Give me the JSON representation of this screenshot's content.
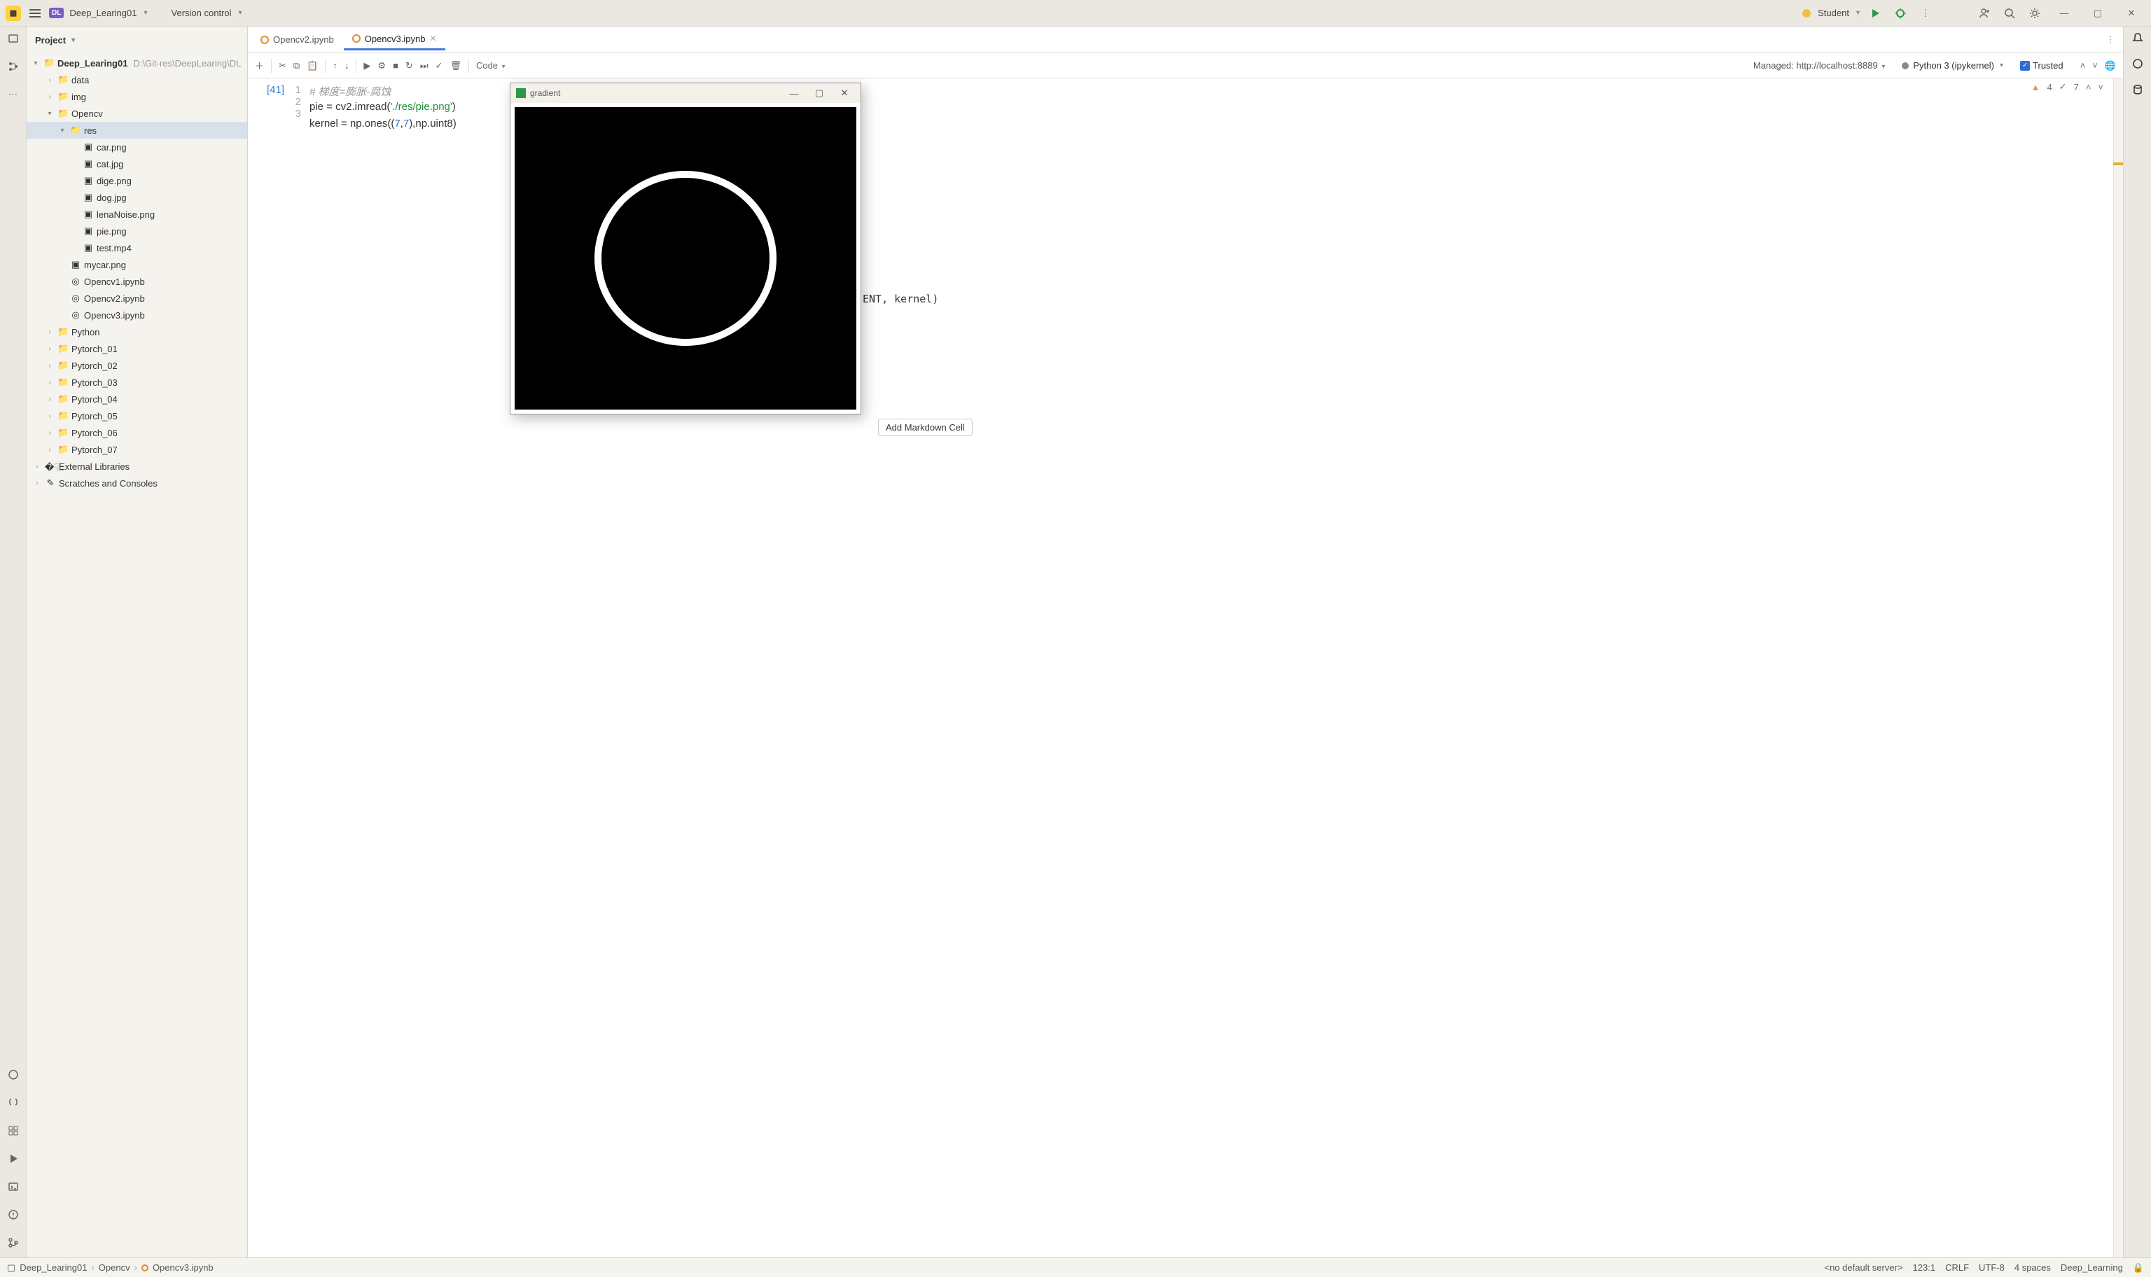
{
  "titlebar": {
    "project": "Deep_Learing01",
    "vcs": "Version control",
    "student": "Student"
  },
  "project_panel": {
    "title": "Project",
    "root": {
      "name": "Deep_Learing01",
      "path": "D:\\Git-res\\DeepLearing\\DL"
    },
    "tree": [
      {
        "indent": 1,
        "arrow": ">",
        "icon": "folder",
        "name": "data"
      },
      {
        "indent": 1,
        "arrow": ">",
        "icon": "folder",
        "name": "img"
      },
      {
        "indent": 1,
        "arrow": "v",
        "icon": "folder",
        "name": "Opencv"
      },
      {
        "indent": 2,
        "arrow": "v",
        "icon": "folder",
        "name": "res",
        "sel": true
      },
      {
        "indent": 3,
        "arrow": "",
        "icon": "img",
        "name": "car.png"
      },
      {
        "indent": 3,
        "arrow": "",
        "icon": "img",
        "name": "cat.jpg"
      },
      {
        "indent": 3,
        "arrow": "",
        "icon": "img",
        "name": "dige.png"
      },
      {
        "indent": 3,
        "arrow": "",
        "icon": "img",
        "name": "dog.jpg"
      },
      {
        "indent": 3,
        "arrow": "",
        "icon": "img",
        "name": "lenaNoise.png"
      },
      {
        "indent": 3,
        "arrow": "",
        "icon": "img",
        "name": "pie.png"
      },
      {
        "indent": 3,
        "arrow": "",
        "icon": "img",
        "name": "test.mp4"
      },
      {
        "indent": 2,
        "arrow": "",
        "icon": "img",
        "name": "mycar.png"
      },
      {
        "indent": 2,
        "arrow": "",
        "icon": "nb",
        "name": "Opencv1.ipynb"
      },
      {
        "indent": 2,
        "arrow": "",
        "icon": "nb",
        "name": "Opencv2.ipynb"
      },
      {
        "indent": 2,
        "arrow": "",
        "icon": "nb",
        "name": "Opencv3.ipynb"
      },
      {
        "indent": 1,
        "arrow": ">",
        "icon": "folder",
        "name": "Python"
      },
      {
        "indent": 1,
        "arrow": ">",
        "icon": "folder",
        "name": "Pytorch_01"
      },
      {
        "indent": 1,
        "arrow": ">",
        "icon": "folder",
        "name": "Pytorch_02"
      },
      {
        "indent": 1,
        "arrow": ">",
        "icon": "folder",
        "name": "Pytorch_03"
      },
      {
        "indent": 1,
        "arrow": ">",
        "icon": "folder",
        "name": "Pytorch_04"
      },
      {
        "indent": 1,
        "arrow": ">",
        "icon": "folder",
        "name": "Pytorch_05"
      },
      {
        "indent": 1,
        "arrow": ">",
        "icon": "folder",
        "name": "Pytorch_06"
      },
      {
        "indent": 1,
        "arrow": ">",
        "icon": "folder",
        "name": "Pytorch_07"
      },
      {
        "indent": 0,
        "arrow": ">",
        "icon": "lib",
        "name": "External Libraries"
      },
      {
        "indent": 0,
        "arrow": ">",
        "icon": "scratch",
        "name": "Scratches and Consoles"
      }
    ]
  },
  "tabs": [
    {
      "label": "Opencv2.ipynb",
      "active": false
    },
    {
      "label": "Opencv3.ipynb",
      "active": true
    }
  ],
  "toolbar": {
    "code_dropdown": "Code",
    "managed": "Managed: http://localhost:8889",
    "kernel": "Python 3 (ipykernel)",
    "trusted": "Trusted"
  },
  "inspections": {
    "warn": "4",
    "ok": "7"
  },
  "cell": {
    "exec": "[41]",
    "lines": [
      {
        "n": "1",
        "html": "<span class='tok-comment'># 梯度=膨胀-腐蚀</span>"
      },
      {
        "n": "2",
        "html": "pie = cv2.imread(<span class='tok-str'>'./res/pie.png'</span>)"
      },
      {
        "n": "3",
        "html": "kernel = np.ones((<span class='tok-num'>7</span>,<span class='tok-num'>7</span>),np.uint8)"
      }
    ],
    "peek": "ENT, kernel)"
  },
  "add_markdown": "Add Markdown Cell",
  "image_window": {
    "title": "gradient"
  },
  "breadcrumb": [
    "Deep_Learing01",
    "Opencv",
    "Opencv3.ipynb"
  ],
  "status": {
    "server": "<no default server>",
    "pos": "123:1",
    "eol": "CRLF",
    "enc": "UTF-8",
    "indent": "4 spaces",
    "env": "Deep_Learning"
  }
}
